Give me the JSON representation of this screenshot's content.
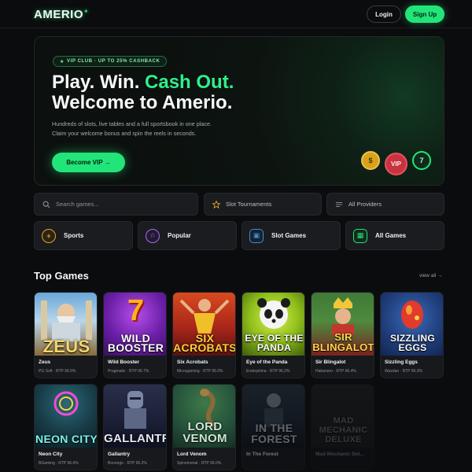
{
  "header": {
    "logo": "AMERIO",
    "login_label": "Login",
    "signup_label": "Sign Up"
  },
  "hero": {
    "pill": "VIP CLUB · UP TO 25% CASHBACK",
    "title_line1_plain": "Play. Win. ",
    "title_line1_accent": "Cash Out.",
    "title_line2": "Welcome to Amerio.",
    "description": "Hundreds of slots, live tables and a full sportsbook in one place. Claim your welcome bonus and spin the reels in seconds.",
    "cta_label": "Become VIP →",
    "chips": {
      "coin": "$",
      "vip": "VIP",
      "seven": "7"
    }
  },
  "filters": {
    "search_placeholder": "Search games...",
    "tournaments_label": "Slot Tournaments",
    "providers_label": "All Providers"
  },
  "categories": [
    {
      "label": "Sports",
      "icon": "plus-circle-icon",
      "glyph": "+",
      "color": "#e0a52b"
    },
    {
      "label": "Popular",
      "icon": "star-icon",
      "glyph": "☆",
      "color": "#a56cf0"
    },
    {
      "label": "Slot Games",
      "icon": "slot-machine-icon",
      "glyph": "▣",
      "color": "#3d8fd6"
    },
    {
      "label": "All Games",
      "icon": "grid-icon",
      "glyph": "▦",
      "color": "#22e57a"
    }
  ],
  "top_games": {
    "title": "Top Games",
    "view_all": "view all →",
    "games": [
      {
        "name": "Zeus",
        "art": "ZEUS",
        "sub": "PG Soft · RTP 96.5%"
      },
      {
        "name": "Wild Booster",
        "art": "WILD BOOSTER",
        "sub": "Pragmatic · RTP 96.7%"
      },
      {
        "name": "Six Acrobats",
        "art": "SIX ACROBATS",
        "sub": "Microgaming · RTP 96.0%"
      },
      {
        "name": "Eye of the Panda",
        "art": "EYE OF THE PANDA",
        "sub": "Endorphina · RTP 96.2%"
      },
      {
        "name": "Sir Blingalot",
        "art": "SIR BLINGALOT",
        "sub": "Habanero · RTP 96.4%"
      },
      {
        "name": "Sizzling Eggs",
        "art": "SIZZLING EGGS",
        "sub": "Wazdan · RTP 96.3%"
      },
      {
        "name": "Neon City",
        "art": "NEON CITY",
        "sub": "BGaming · RTP 96.6%"
      },
      {
        "name": "Gallantry",
        "art": "GALLANTRY",
        "sub": "Booongo · RTP 96.2%"
      },
      {
        "name": "Lord Venom",
        "art": "LORD VENOM",
        "sub": "Spinomenal · RTP 96.0%"
      },
      {
        "name": "In The Forest",
        "art": "IN THE FOREST",
        "sub": ""
      },
      {
        "name": "Mad Mechanic Del...",
        "art": "MAD MECHANIC DELUXE",
        "sub": ""
      }
    ]
  }
}
